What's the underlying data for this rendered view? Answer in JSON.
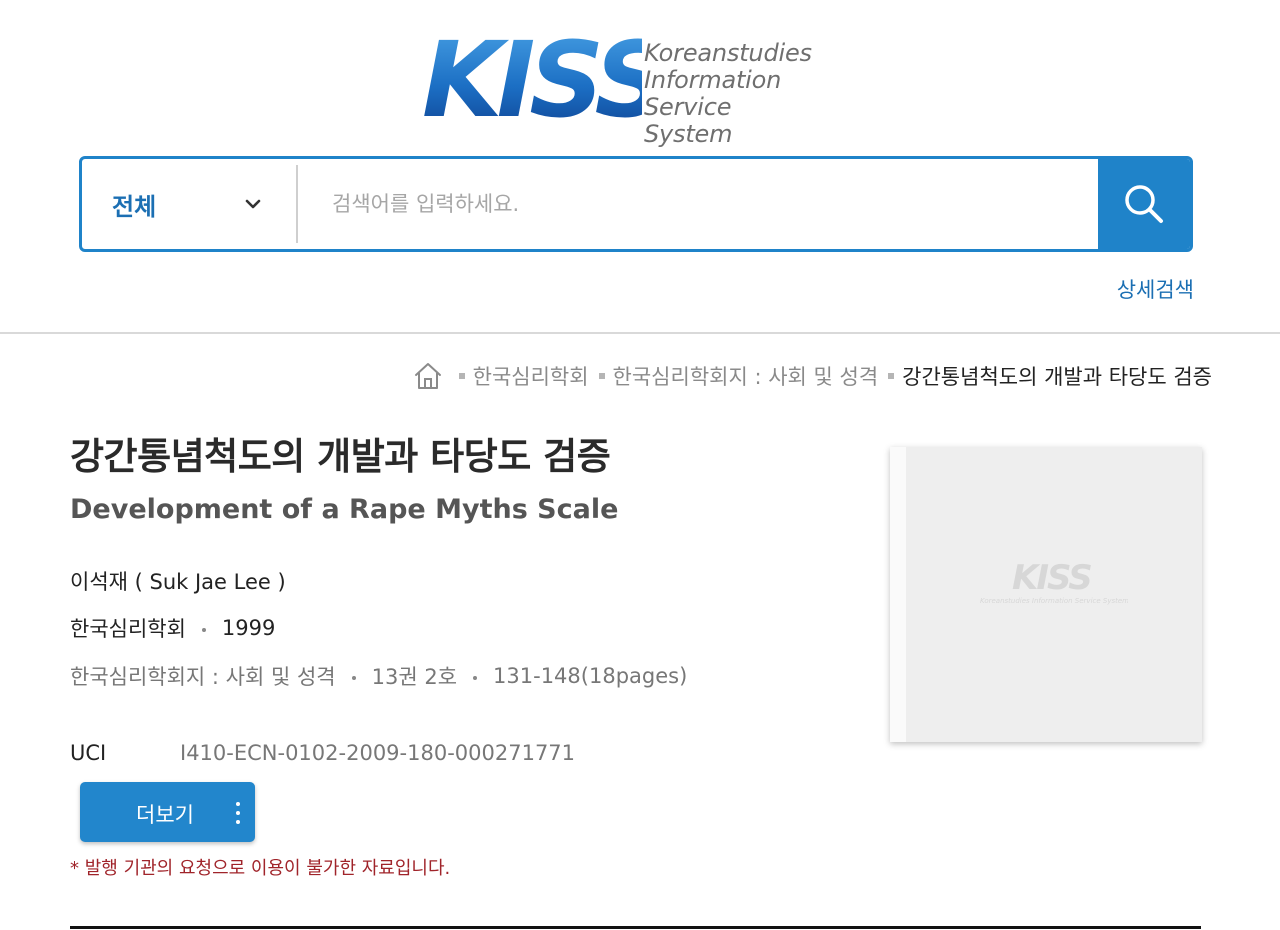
{
  "header": {
    "logo_mark": "KISS",
    "logo_lines": [
      "Koreanstudies",
      "Information",
      "Service System"
    ],
    "brand_color": "#1f83c9"
  },
  "search": {
    "scope_selected": "전체",
    "placeholder": "검색어를 입력하세요.",
    "value": "",
    "search_icon": "search-icon",
    "scope_icon": "chevron-down-icon"
  },
  "advanced_search_label": "상세검색",
  "breadcrumb": {
    "home_icon": "home-icon",
    "items": [
      "한국심리학회",
      "한국심리학회지 : 사회 및 성격",
      "강간통념척도의 개발과 타당도 검증"
    ]
  },
  "article": {
    "title_ko": "강간통념척도의 개발과 타당도 검증",
    "title_en": "Development of a Rape Myths Scale",
    "author": "이석재 ( Suk Jae Lee )",
    "publisher": "한국심리학회",
    "year": "1999",
    "journal": "한국심리학회지 : 사회 및 성격",
    "volume": "13권 2호",
    "pages": "131-148(18pages)",
    "uci_label": "UCI",
    "uci_value": "I410-ECN-0102-2009-180-000271771"
  },
  "actions": {
    "more_label": "더보기",
    "more_icon": "kebab-menu-icon"
  },
  "notice": "* 발행 기관의 요청으로 이용이 불가한 자료입니다.",
  "cover": {
    "logo_mark": "KISS",
    "logo_caption": "Koreanstudies Information Service System"
  },
  "colors": {
    "accent": "#1f83c9",
    "link": "#1b6fb3",
    "notice": "#a0242a"
  }
}
